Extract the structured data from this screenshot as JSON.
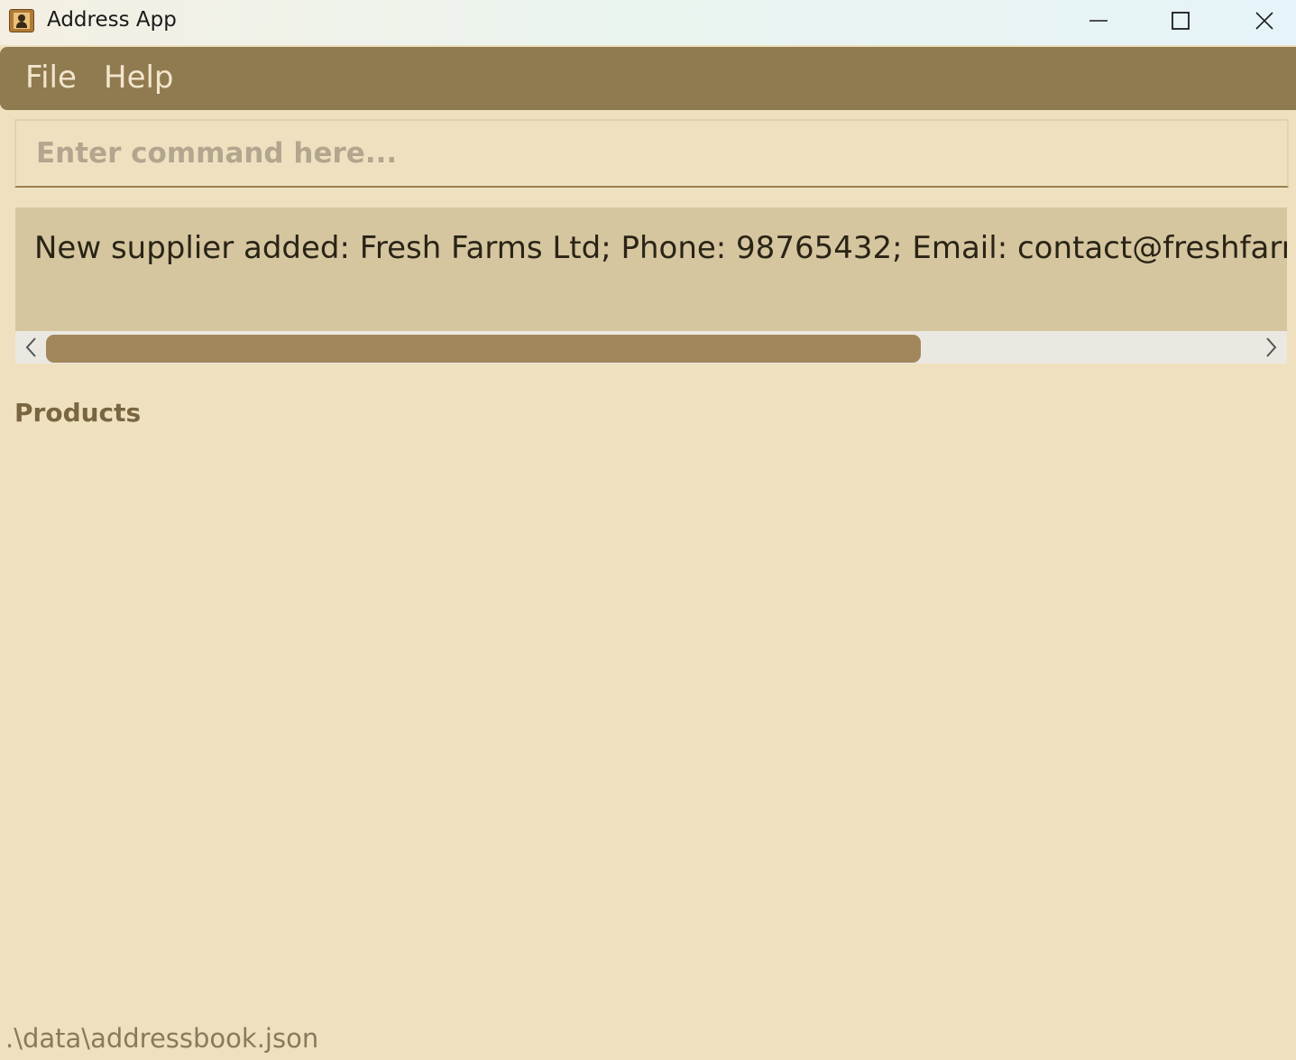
{
  "window": {
    "title": "Address App"
  },
  "menu": {
    "file_label": "File",
    "help_label": "Help"
  },
  "command": {
    "placeholder": "Enter command here...",
    "value": ""
  },
  "result": {
    "message": "New supplier added: Fresh Farms Ltd; Phone: 98765432; Email: contact@freshfarms.com; Address"
  },
  "products": {
    "heading": "Products"
  },
  "status": {
    "file_path": ".\\data\\addressbook.json"
  },
  "colors": {
    "background": "#efe1bf",
    "menubar": "#907a50",
    "result_background": "#d5c6a0",
    "scroll_thumb": "#a2875c"
  },
  "icons": {
    "app": "address-book-icon",
    "minimize": "minimize-icon",
    "maximize": "maximize-icon",
    "close": "close-icon",
    "scroll_left": "chevron-left-icon",
    "scroll_right": "chevron-right-icon"
  }
}
